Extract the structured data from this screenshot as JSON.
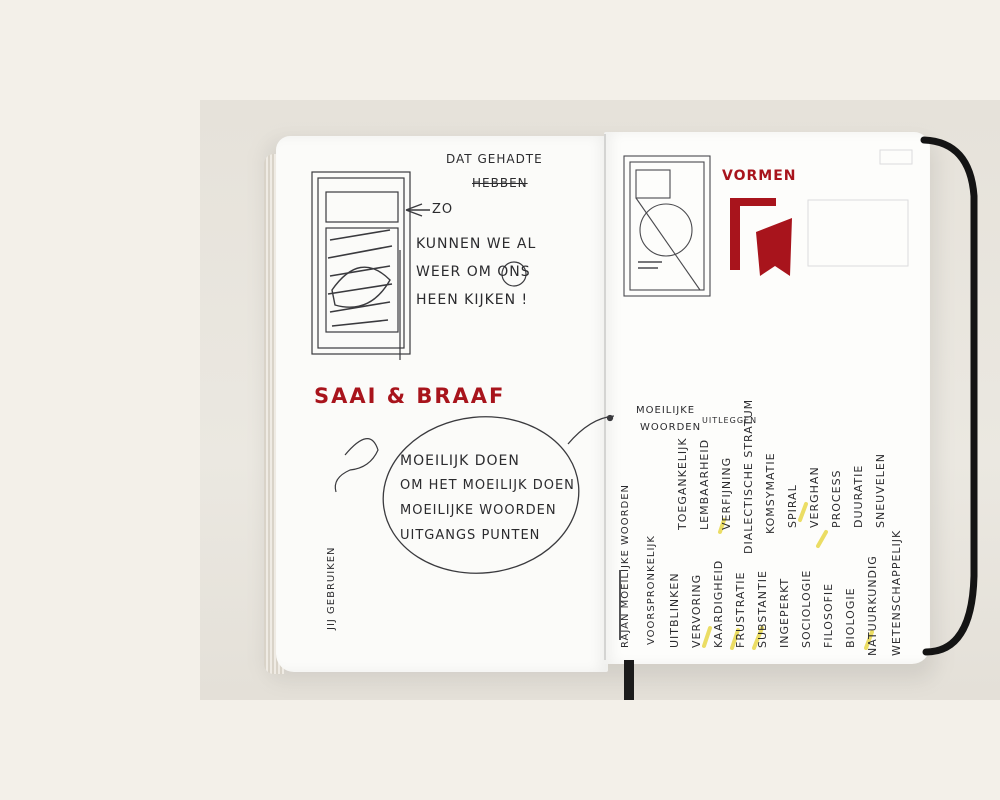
{
  "notebook": {
    "left_page": {
      "top_note_line1": "DAT GEHADTE",
      "top_note_line2": "HEBBEN",
      "arrow_note": "ZO",
      "note_lines": [
        "KUNNEN WE AL",
        "WEER OM ONS",
        "HEEN KIJKEN !"
      ],
      "title": "SAAI & BRAAF",
      "bubble_lines": [
        "MOEILIJK DOEN",
        "OM HET MOEILIJK DOEN",
        "MOEILIJKE WOORDEN",
        "UITGANGS PUNTEN"
      ],
      "side_note": "JIJ GEBRUIKEN"
    },
    "right_page": {
      "title": "VORMEN",
      "callout_line1": "MOEILIJKE",
      "callout_line2": "WOORDEN",
      "callout_extra": "UITLEGGEN",
      "column_header": "RAJAN MOEILIJKE WOORDEN",
      "column_header2": "VOORSPRONKELIJK",
      "word_list": [
        "UITBLINKEN",
        "TOEGANKELIJK",
        "VERVORING",
        "LEMBAARHEID",
        "KAARDIGHEID",
        "VERFIJNING",
        "FRUSTRATIE",
        "DIALECTISCHE STRATUM",
        "SUBSTANTIE",
        "KOMSYMATIE",
        "INGEPERKT",
        "SPIRAL",
        "SOCIOLOGIE",
        "VERGHAN",
        "FILOSOFIE",
        "PROCESS",
        "BIOLOGIE",
        "DUURATIE",
        "NATUURKUNDIG",
        "SNEUVELEN",
        "WETENSCHAPPELIJK"
      ]
    }
  },
  "colors": {
    "ink": "#2b2b2e",
    "marker_red": "#a8141c",
    "highlight_yellow": "#e9d84a",
    "strap": "#141414"
  }
}
